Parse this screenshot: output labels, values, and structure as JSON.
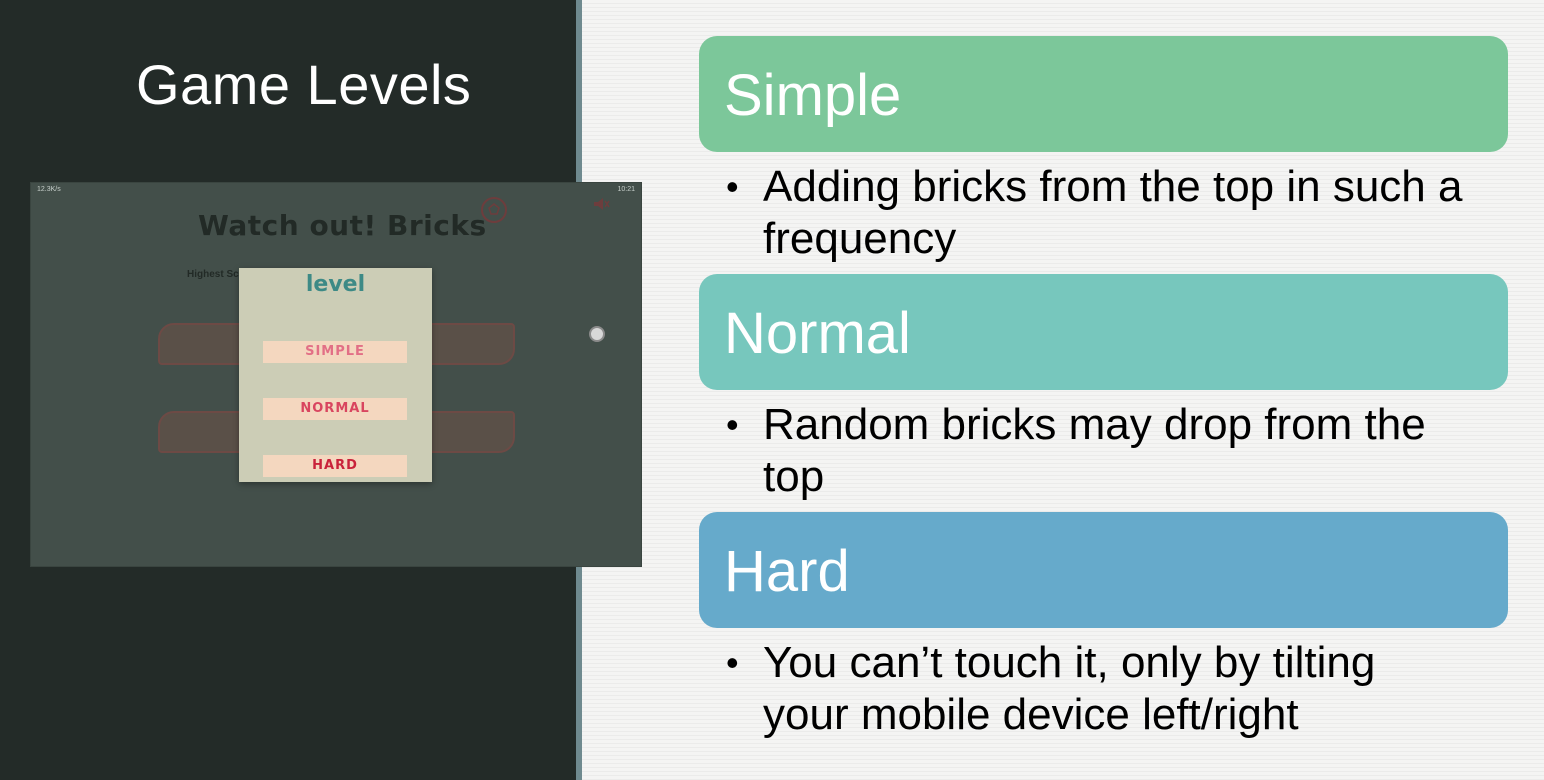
{
  "slide": {
    "title": "Game Levels"
  },
  "game_screenshot": {
    "status_left": "12.3K/s",
    "status_right": "10:21",
    "title": "Watch out! Bricks",
    "highest_label": "Highest Sc",
    "dialog": {
      "title": "level",
      "buttons": [
        "SIMPLE",
        "NORMAL",
        "HARD"
      ]
    }
  },
  "levels": [
    {
      "name": "Simple",
      "color": "#7cc79a",
      "description": "Adding bricks from the top in such a frequency"
    },
    {
      "name": "Normal",
      "color": "#77c7bd",
      "description": "Random bricks may drop from the top"
    },
    {
      "name": "Hard",
      "color": "#66aacb",
      "description": "You can’t touch it, only by tilting your mobile device left/right"
    }
  ],
  "bullet_glyph": "•"
}
